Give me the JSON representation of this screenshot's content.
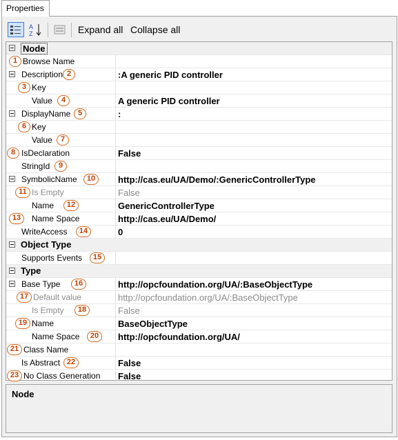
{
  "tab": {
    "label": "Properties"
  },
  "toolbar": {
    "expand_all": "Expand all",
    "collapse_all": "Collapse all"
  },
  "rows": [
    {
      "label": "Node",
      "value": "",
      "type": "category",
      "badge": ""
    },
    {
      "label": "Browse Name",
      "value": "",
      "badge": "1"
    },
    {
      "label": "Description",
      "value": ":A generic PID controller",
      "badge": "2",
      "expander": true
    },
    {
      "label": "Key",
      "value": "",
      "badge": "3"
    },
    {
      "label": "Value",
      "value": "A generic PID controller",
      "badge": "4"
    },
    {
      "label": "DisplayName",
      "value": ":",
      "badge": "5",
      "expander": true
    },
    {
      "label": "Key",
      "value": "",
      "badge": "6"
    },
    {
      "label": "Value",
      "value": "",
      "badge": "7"
    },
    {
      "label": "IsDeclaration",
      "value": "False",
      "badge": "8"
    },
    {
      "label": "StringId",
      "value": "",
      "badge": "9"
    },
    {
      "label": "SymbolicName",
      "value": "http://cas.eu/UA/Demo/:GenericControllerType",
      "badge": "10",
      "expander": true
    },
    {
      "label": "Is Empty",
      "value": "False",
      "badge": "11",
      "gray": true
    },
    {
      "label": "Name",
      "value": "GenericControllerType",
      "badge": "12"
    },
    {
      "label": "Name Space",
      "value": "http://cas.eu/UA/Demo/",
      "badge": "13"
    },
    {
      "label": "WriteAccess",
      "value": "0",
      "badge": "14"
    },
    {
      "label": "Object Type",
      "value": "",
      "type": "category",
      "badge": ""
    },
    {
      "label": "Supports Events",
      "value": "",
      "badge": "15"
    },
    {
      "label": "Type",
      "value": "",
      "type": "category",
      "badge": ""
    },
    {
      "label": "Base Type",
      "value": "http://opcfoundation.org/UA/:BaseObjectType",
      "badge": "16",
      "expander": true
    },
    {
      "label": "Default value",
      "value": "http://opcfoundation.org/UA/:BaseObjectType",
      "badge": "17",
      "gray": true
    },
    {
      "label": "Is Empty",
      "value": "False",
      "badge": "18",
      "gray": true
    },
    {
      "label": "Name",
      "value": "BaseObjectType",
      "badge": "19"
    },
    {
      "label": "Name Space",
      "value": "http://opcfoundation.org/UA/",
      "badge": "20"
    },
    {
      "label": "Class Name",
      "value": "",
      "badge": "21"
    },
    {
      "label": "Is Abstract",
      "value": "False",
      "badge": "22"
    },
    {
      "label": "No Class Generation",
      "value": "False",
      "badge": "23"
    }
  ],
  "description": {
    "title": "Node"
  },
  "icons": {
    "categorized": "categorized-icon",
    "alphabetical": "alphabetical-sort-icon",
    "property_pages": "property-pages-icon"
  }
}
